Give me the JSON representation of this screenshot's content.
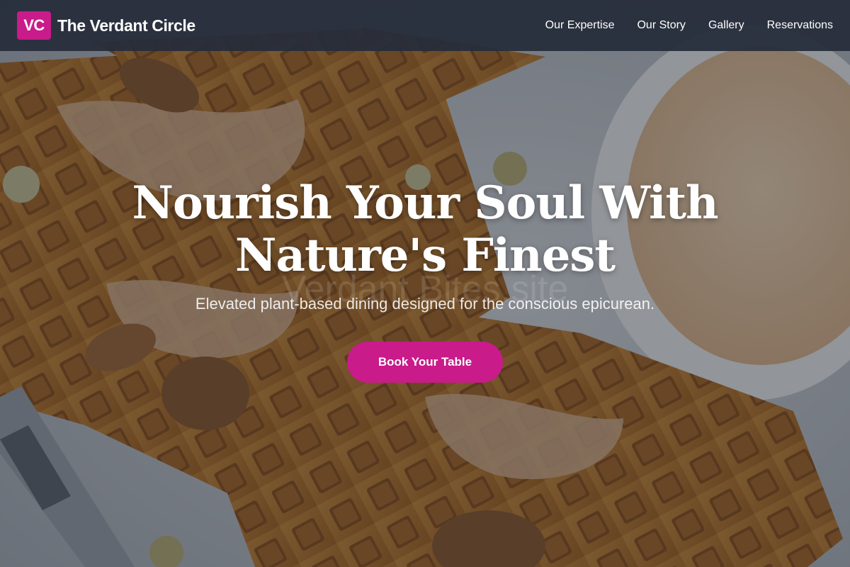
{
  "brand": {
    "logo_text": "VC",
    "name": "The Verdant Circle"
  },
  "nav": {
    "items": [
      {
        "label": "Our Expertise"
      },
      {
        "label": "Our Story"
      },
      {
        "label": "Gallery"
      },
      {
        "label": "Reservations"
      }
    ]
  },
  "hero": {
    "title_line1": "Nourish Your Soul With",
    "title_line2": "Nature's Finest",
    "subtitle": "Elevated plant-based dining designed for the conscious epicurean.",
    "watermark": "Verdant Bites.site",
    "cta_label": "Book Your Table",
    "background_description_icon": "waffle-food-photo"
  },
  "colors": {
    "accent": "#c91b8a",
    "navbar_bg": "#262c3a",
    "text": "#ffffff"
  }
}
